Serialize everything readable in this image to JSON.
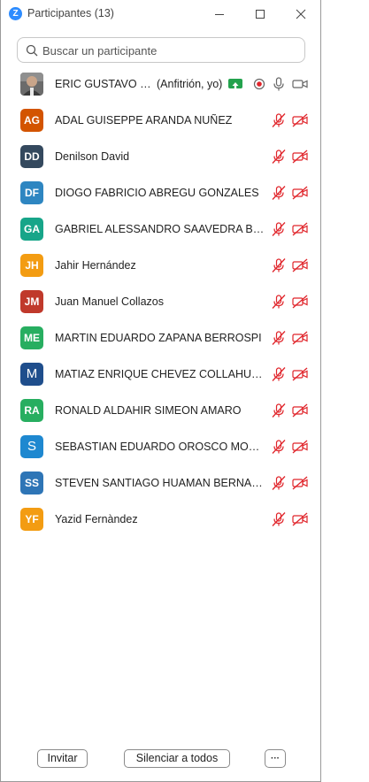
{
  "window": {
    "logo_letter": "Z",
    "title": "Participantes (13)"
  },
  "search": {
    "placeholder": "Buscar un participante"
  },
  "host": {
    "name": "ERIC GUSTAVO C...",
    "role": "(Anfitrión, yo)"
  },
  "participants": [
    {
      "initials": "AG",
      "name": "ADAL GUISEPPE ARANDA NUÑEZ",
      "color": "#D35400"
    },
    {
      "initials": "DD",
      "name": "Denilson David",
      "color": "#34495E"
    },
    {
      "initials": "DF",
      "name": "DIOGO FABRICIO ABREGU GONZALES",
      "color": "#2E86C1"
    },
    {
      "initials": "GA",
      "name": "GABRIEL ALESSANDRO SAAVEDRA BALA...",
      "color": "#17A589"
    },
    {
      "initials": "JH",
      "name": "Jahir Hernández",
      "color": "#F39C12"
    },
    {
      "initials": "JM",
      "name": "Juan Manuel Collazos",
      "color": "#C0392B"
    },
    {
      "initials": "ME",
      "name": "MARTIN EDUARDO ZAPANA BERROSPI",
      "color": "#27AE60"
    },
    {
      "initials": "M",
      "name": "MATIAZ ENRIQUE CHEVEZ COLLAHUAC...",
      "color": "#1F4E8C"
    },
    {
      "initials": "RA",
      "name": "RONALD ALDAHIR SIMEON AMARO",
      "color": "#27AE60"
    },
    {
      "initials": "S",
      "name": "SEBASTIAN EDUARDO OROSCO MONT...",
      "color": "#1E88D0"
    },
    {
      "initials": "SS",
      "name": "STEVEN SANTIAGO HUAMAN BERNAR...",
      "color": "#2E75B6"
    },
    {
      "initials": "YF",
      "name": "Yazid Fernàndez",
      "color": "#F39C12"
    }
  ],
  "footer": {
    "invite_label": "Invitar",
    "mute_all_label": "Silenciar a todos",
    "more_label": "···"
  },
  "icons": {
    "muted_mic": "mic-muted-icon",
    "video_off": "video-off-icon",
    "accent": "#E0242A"
  }
}
